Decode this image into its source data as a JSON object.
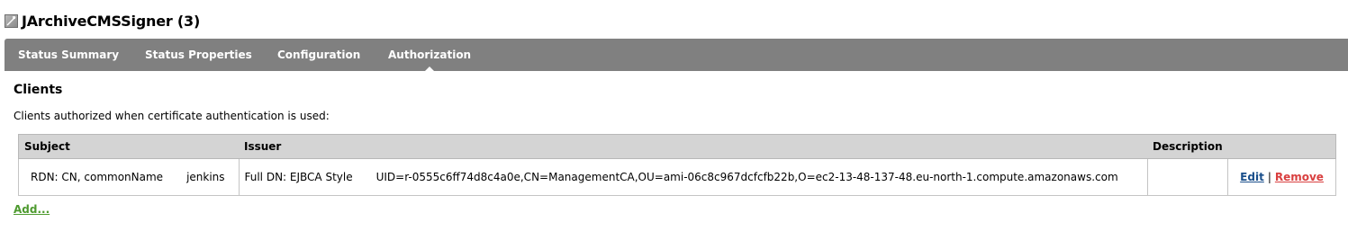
{
  "header": {
    "icon": "worker-icon",
    "title": "JArchiveCMSSigner (3)"
  },
  "tabs": [
    {
      "label": "Status Summary",
      "active": false
    },
    {
      "label": "Status Properties",
      "active": false
    },
    {
      "label": "Configuration",
      "active": false
    },
    {
      "label": "Authorization",
      "active": true
    }
  ],
  "clients_section": {
    "heading": "Clients",
    "description": "Clients authorized when certificate authentication is used:",
    "table": {
      "columns": [
        "Subject",
        "Issuer",
        "Description",
        ""
      ],
      "rows": [
        {
          "subject_type": "RDN: CN, commonName",
          "subject_value": "jenkins",
          "issuer_type": "Full DN: EJBCA Style",
          "issuer_value": "UID=r-0555c6ff74d8c4a0e,CN=ManagementCA,OU=ami-06c8c967dcfcfb22b,O=ec2-13-48-137-48.eu-north-1.compute.amazonaws.com",
          "description": "",
          "actions": {
            "edit": "Edit",
            "separator": "|",
            "remove": "Remove"
          }
        }
      ]
    },
    "add_label": "Add..."
  },
  "colors": {
    "tabbar_bg": "#808080",
    "table_header_bg": "#d4d4d4",
    "edit_link": "#1a4f8b",
    "remove_link": "#d93f3f",
    "add_link": "#4e9a2f"
  }
}
